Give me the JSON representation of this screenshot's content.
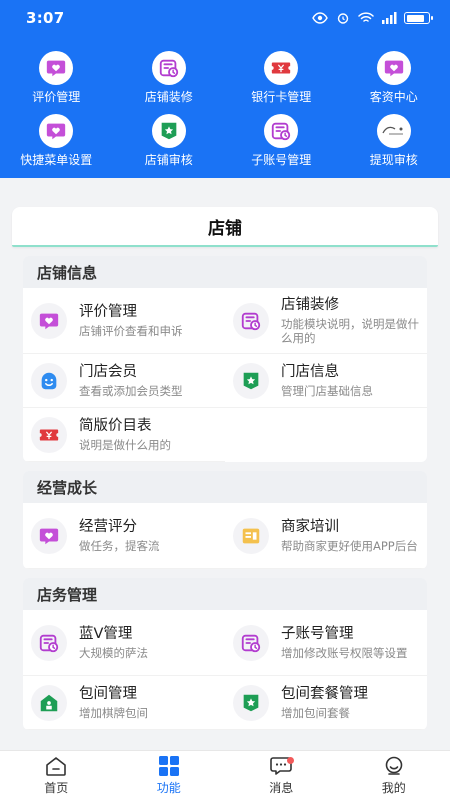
{
  "status_bar": {
    "time": "3:07"
  },
  "quick_menu": [
    {
      "label": "评价管理",
      "icon": "heart-chat-icon"
    },
    {
      "label": "店铺装修",
      "icon": "clock-doc-icon"
    },
    {
      "label": "银行卡管理",
      "icon": "ticket-icon"
    },
    {
      "label": "客资中心",
      "icon": "heart-chat-icon"
    },
    {
      "label": "快捷菜单设置",
      "icon": "heart-chat-icon"
    },
    {
      "label": "店铺审核",
      "icon": "star-shield-icon"
    },
    {
      "label": "子账号管理",
      "icon": "clock-doc-icon"
    },
    {
      "label": "提现审核",
      "icon": "logo-icon"
    }
  ],
  "tab": {
    "label": "店铺"
  },
  "sections": {
    "shop_info": {
      "title": "店铺信息",
      "items": [
        {
          "title": "评价管理",
          "desc": "店铺评价查看和申诉"
        },
        {
          "title": "店铺装修",
          "desc": "功能模块说明，说明是做什么用的"
        },
        {
          "title": "门店会员",
          "desc": "查看或添加会员类型"
        },
        {
          "title": "门店信息",
          "desc": "管理门店基础信息"
        },
        {
          "title": "简版价目表",
          "desc": "说明是做什么用的"
        }
      ]
    },
    "growth": {
      "title": "经营成长",
      "items": [
        {
          "title": "经营评分",
          "desc": "做任务，提客流"
        },
        {
          "title": "商家培训",
          "desc": "帮助商家更好使用APP后台"
        }
      ]
    },
    "store_mgmt": {
      "title": "店务管理",
      "items": [
        {
          "title": "蓝V管理",
          "desc": "大规模的萨法"
        },
        {
          "title": "子账号管理",
          "desc": "增加修改账号权限等设置"
        },
        {
          "title": "包间管理",
          "desc": "增加棋牌包间"
        },
        {
          "title": "包间套餐管理",
          "desc": "增加包间套餐"
        }
      ]
    }
  },
  "bottom_nav": [
    {
      "label": "首页"
    },
    {
      "label": "功能"
    },
    {
      "label": "消息"
    },
    {
      "label": "我的"
    }
  ],
  "colors": {
    "primary": "#1a73f5",
    "accent_purple": "#b23ccf",
    "accent_green": "#1e9e55",
    "accent_red": "#e0393e"
  }
}
